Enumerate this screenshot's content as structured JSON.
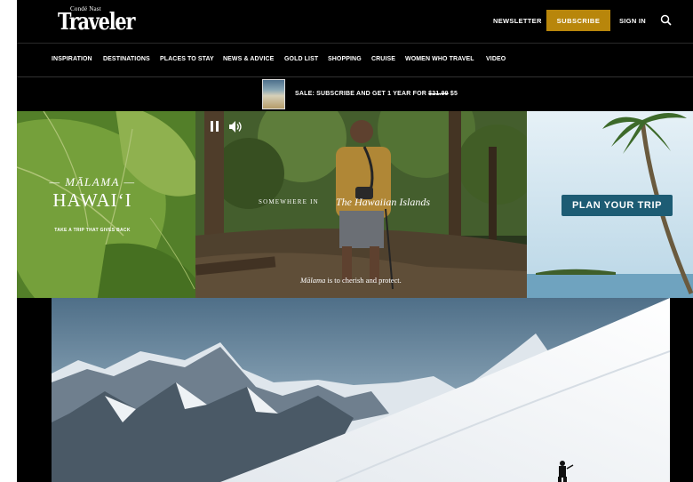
{
  "header": {
    "logo_small": "Condé Nast",
    "logo_main": "Traveler",
    "newsletter_label": "NEWSLETTER",
    "subscribe_label": "SUBSCRIBE",
    "signin_label": "SIGN IN",
    "accent_color": "#b8860b"
  },
  "nav": {
    "items": [
      {
        "label": "INSPIRATION"
      },
      {
        "label": "DESTINATIONS"
      },
      {
        "label": "PLACES TO STAY"
      },
      {
        "label": "NEWS & ADVICE"
      },
      {
        "label": "GOLD LIST"
      },
      {
        "label": "SHOPPING"
      },
      {
        "label": "CRUISE"
      },
      {
        "label": "WOMEN WHO TRAVEL"
      },
      {
        "label": "VIDEO"
      }
    ]
  },
  "promo": {
    "text": "SALE: SUBSCRIBE AND GET 1 YEAR FOR ",
    "old_price": "$21.99",
    "new_price": " $5"
  },
  "ad": {
    "malama": "— MĀLAMA —",
    "hawaii": "HAWAIʻI",
    "tagline": "TAKE A TRIP THAT GIVES BACK",
    "somewhere": "SOMEWHERE IN",
    "islands": "The Hawaiian Islands",
    "caption_italic": "Mālama",
    "caption_rest": " is to cherish and protect.",
    "cta_label": "PLAN YOUR TRIP",
    "cta_color": "#1d5c74"
  },
  "icons": {
    "search": "search-icon",
    "pause": "pause-icon",
    "volume": "volume-icon"
  }
}
